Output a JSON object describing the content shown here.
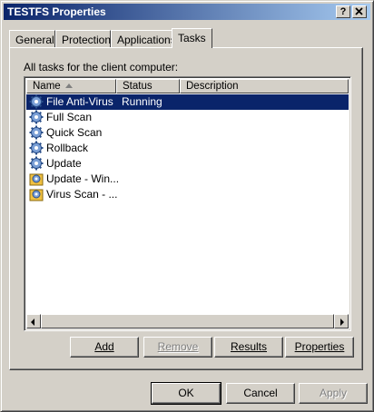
{
  "window": {
    "title": "TESTFS Properties",
    "help_btn": "?",
    "close_btn": "X"
  },
  "tabs": [
    "General",
    "Protection",
    "Applications",
    "Tasks"
  ],
  "active_tab": "Tasks",
  "panel": {
    "caption": "All tasks for the client computer:",
    "columns": [
      "Name",
      "Status",
      "Description"
    ],
    "rows": [
      {
        "name": "File Anti-Virus",
        "status": "Running",
        "icon": "gear-task-icon",
        "selected": true
      },
      {
        "name": "Full Scan",
        "status": "",
        "icon": "gear-task-icon"
      },
      {
        "name": "Quick Scan",
        "status": "",
        "icon": "gear-task-icon"
      },
      {
        "name": "Rollback",
        "status": "",
        "icon": "gear-task-icon"
      },
      {
        "name": "Update",
        "status": "",
        "icon": "gear-task-icon"
      },
      {
        "name": "Update - Win...",
        "status": "",
        "icon": "user-task-icon"
      },
      {
        "name": "Virus Scan - ...",
        "status": "",
        "icon": "user-task-icon"
      }
    ],
    "buttons": {
      "add": "Add",
      "remove": "Remove",
      "results": "Results",
      "properties": "Properties"
    }
  },
  "footer": {
    "ok": "OK",
    "cancel": "Cancel",
    "apply": "Apply"
  },
  "colors": {
    "title_start": "#0a246a",
    "title_end": "#a6caf0",
    "face": "#d4d0c8",
    "selection": "#0a246a"
  }
}
